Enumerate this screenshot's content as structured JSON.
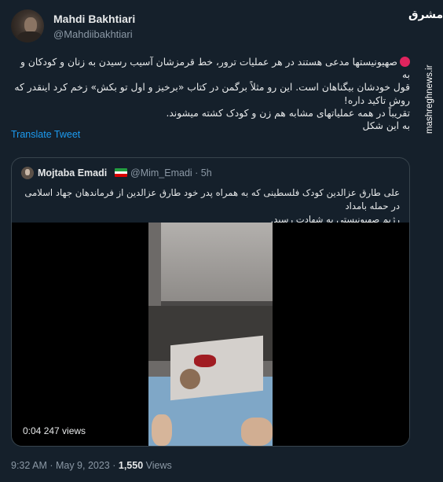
{
  "author": {
    "name": "Mahdi Bakhtiari",
    "handle": "@Mahdiibakhtiari"
  },
  "tweet": {
    "lines": [
      "صهیونیستها مدعی هستند در هر عملیات ترور، خط قرمزشان آسیب رسیدن به زنان و کودکان و به",
      "قول خودشان بیگناهان است. این رو مثلاً برگمن در کتاب «برخیز و اول تو بکش» زخم کرد اینقدر که",
      "روش تاکید داره!",
      "تقریباً در همه عملیاتهای مشابه هم زن و کودک کشته میشوند.",
      "به این شکل"
    ]
  },
  "translate_label": "Translate Tweet",
  "quote": {
    "name": "Mojtaba Emadi",
    "handle_time": "@Mim_Emadi · 5h",
    "text_lines": [
      "علی طارق عزالدین کودک فلسطینی که به همراه پدر خود طارق عزالدین از فرماندهان جهاد اسلامی در حمله بامداد",
      "رژیم صهیونیستی به شهادت رسید."
    ],
    "video_badge": "0:04  247 views"
  },
  "footer": {
    "time": "9:32 AM · May 9, 2023 · ",
    "views_count": "1,550",
    "views_label": " Views"
  },
  "watermark": {
    "logo": "مشرق",
    "text": "mashreghnews.ir"
  }
}
